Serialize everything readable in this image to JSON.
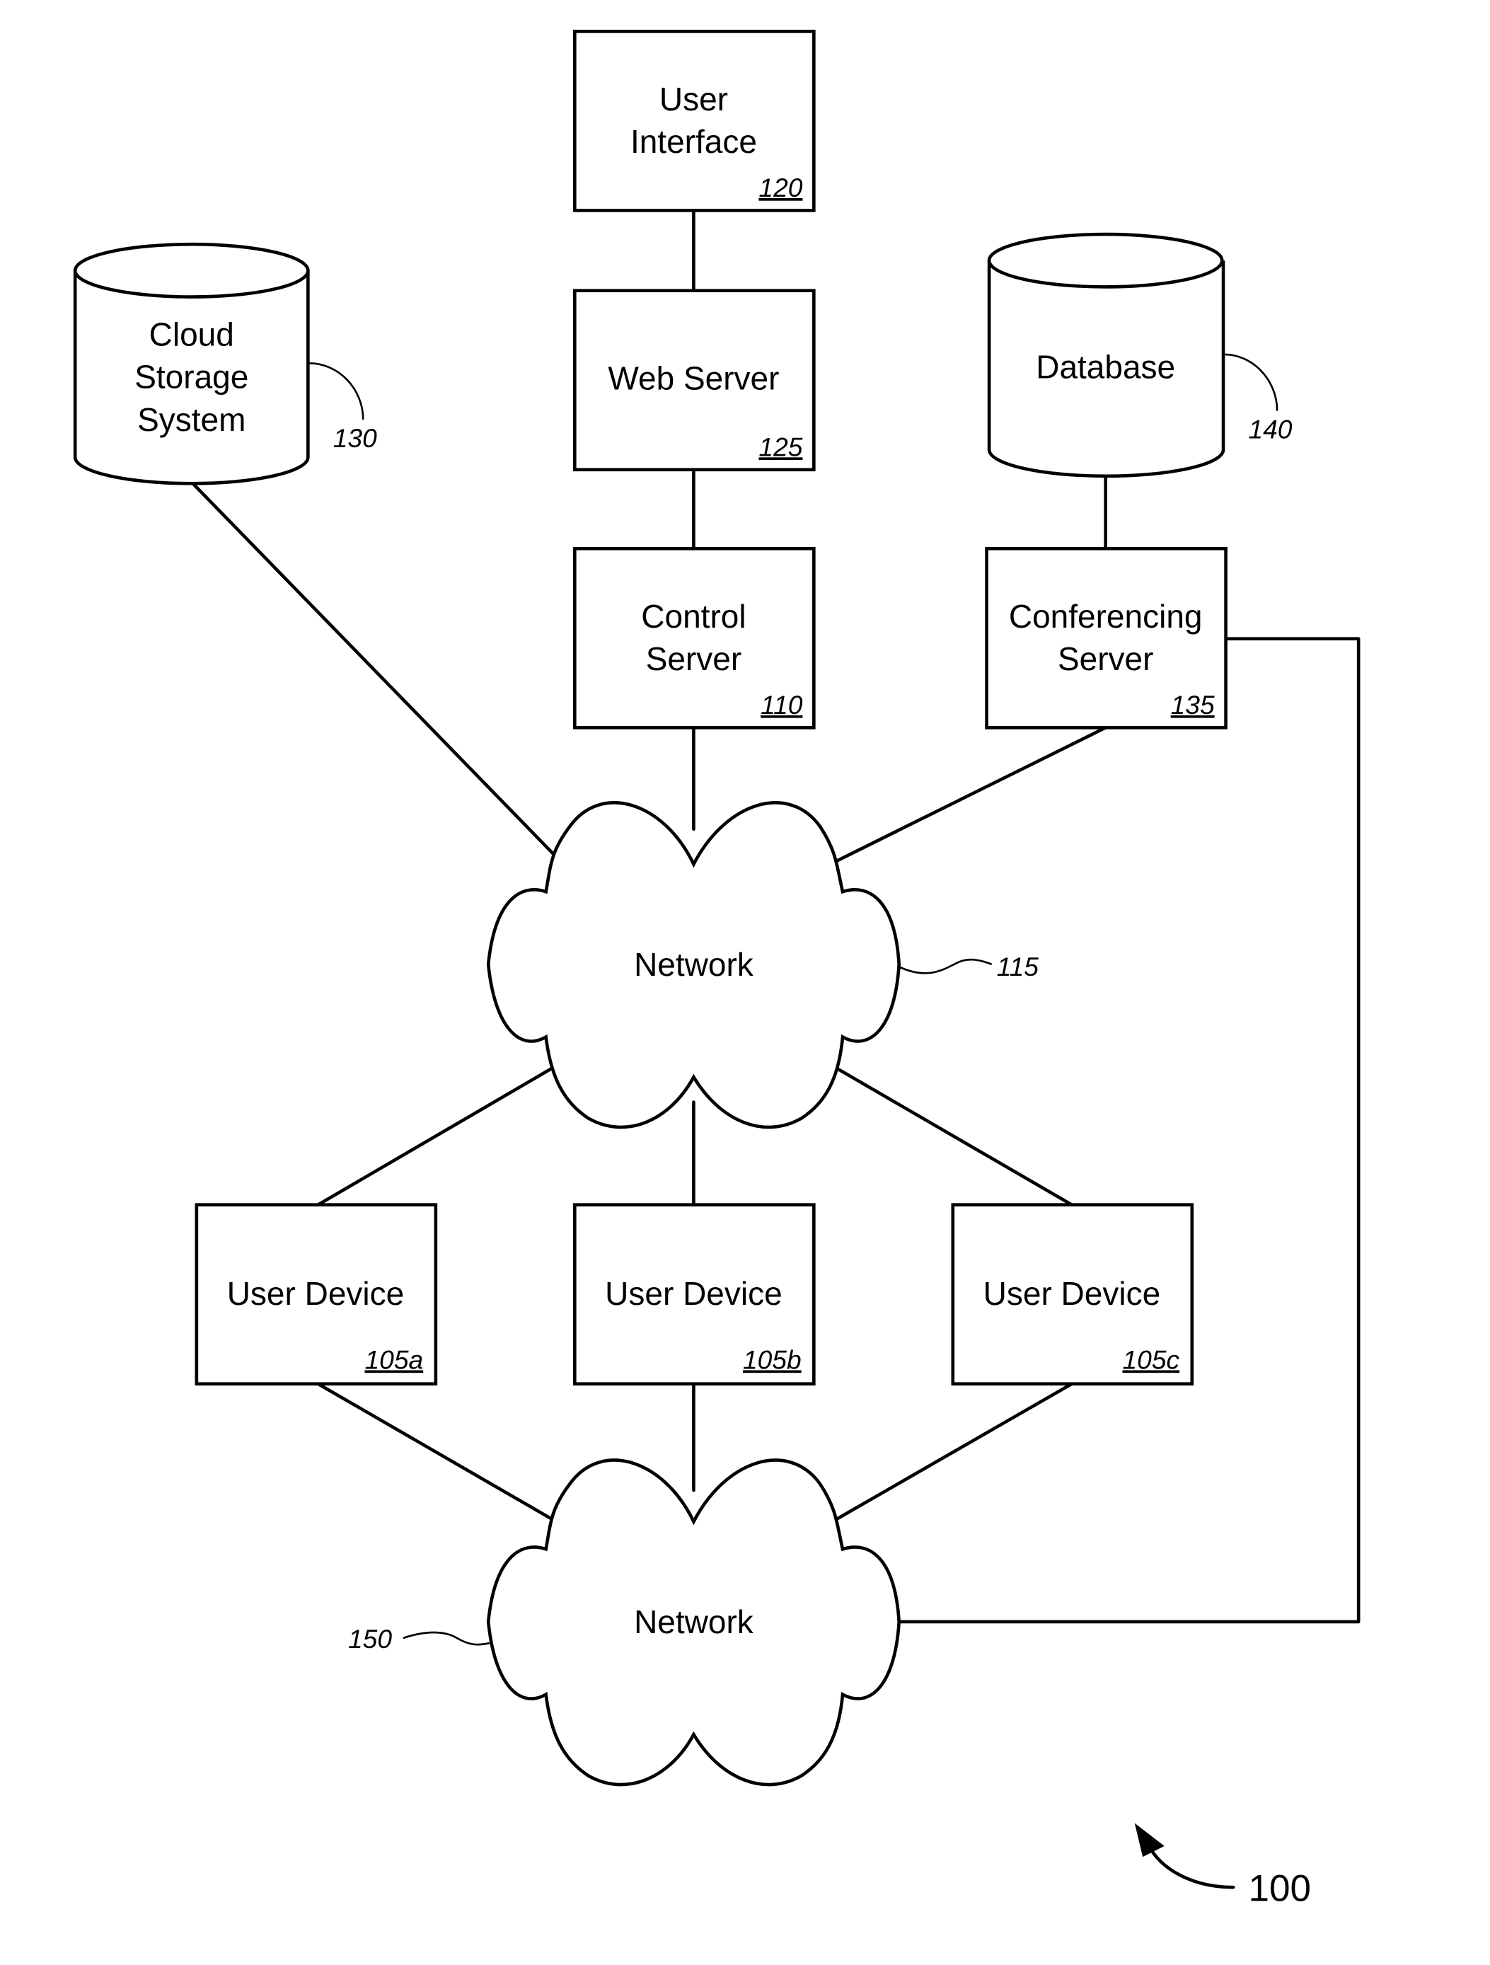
{
  "figure": {
    "number": "100"
  },
  "nodes": {
    "user_interface": {
      "lines": [
        "User",
        "Interface"
      ],
      "ref": "120"
    },
    "web_server": {
      "lines": [
        "Web Server"
      ],
      "ref": "125"
    },
    "control_server": {
      "lines": [
        "Control",
        "Server"
      ],
      "ref": "110"
    },
    "conferencing_server": {
      "lines": [
        "Conferencing",
        "Server"
      ],
      "ref": "135"
    },
    "cloud_storage": {
      "lines": [
        "Cloud",
        "Storage",
        "System"
      ],
      "ref": "130"
    },
    "database": {
      "lines": [
        "Database"
      ],
      "ref": "140"
    },
    "network_115": {
      "lines": [
        "Network"
      ],
      "ref": "115"
    },
    "network_150": {
      "lines": [
        "Network"
      ],
      "ref": "150"
    },
    "user_device_a": {
      "lines": [
        "User Device"
      ],
      "ref": "105a"
    },
    "user_device_b": {
      "lines": [
        "User Device"
      ],
      "ref": "105b"
    },
    "user_device_c": {
      "lines": [
        "User Device"
      ],
      "ref": "105c"
    }
  },
  "connections": [
    [
      "user_interface",
      "web_server"
    ],
    [
      "web_server",
      "control_server"
    ],
    [
      "control_server",
      "network_115"
    ],
    [
      "cloud_storage",
      "network_115"
    ],
    [
      "database",
      "conferencing_server"
    ],
    [
      "conferencing_server",
      "network_115"
    ],
    [
      "conferencing_server",
      "network_150"
    ],
    [
      "network_115",
      "user_device_a"
    ],
    [
      "network_115",
      "user_device_b"
    ],
    [
      "network_115",
      "user_device_c"
    ],
    [
      "user_device_a",
      "network_150"
    ],
    [
      "user_device_b",
      "network_150"
    ],
    [
      "user_device_c",
      "network_150"
    ]
  ]
}
